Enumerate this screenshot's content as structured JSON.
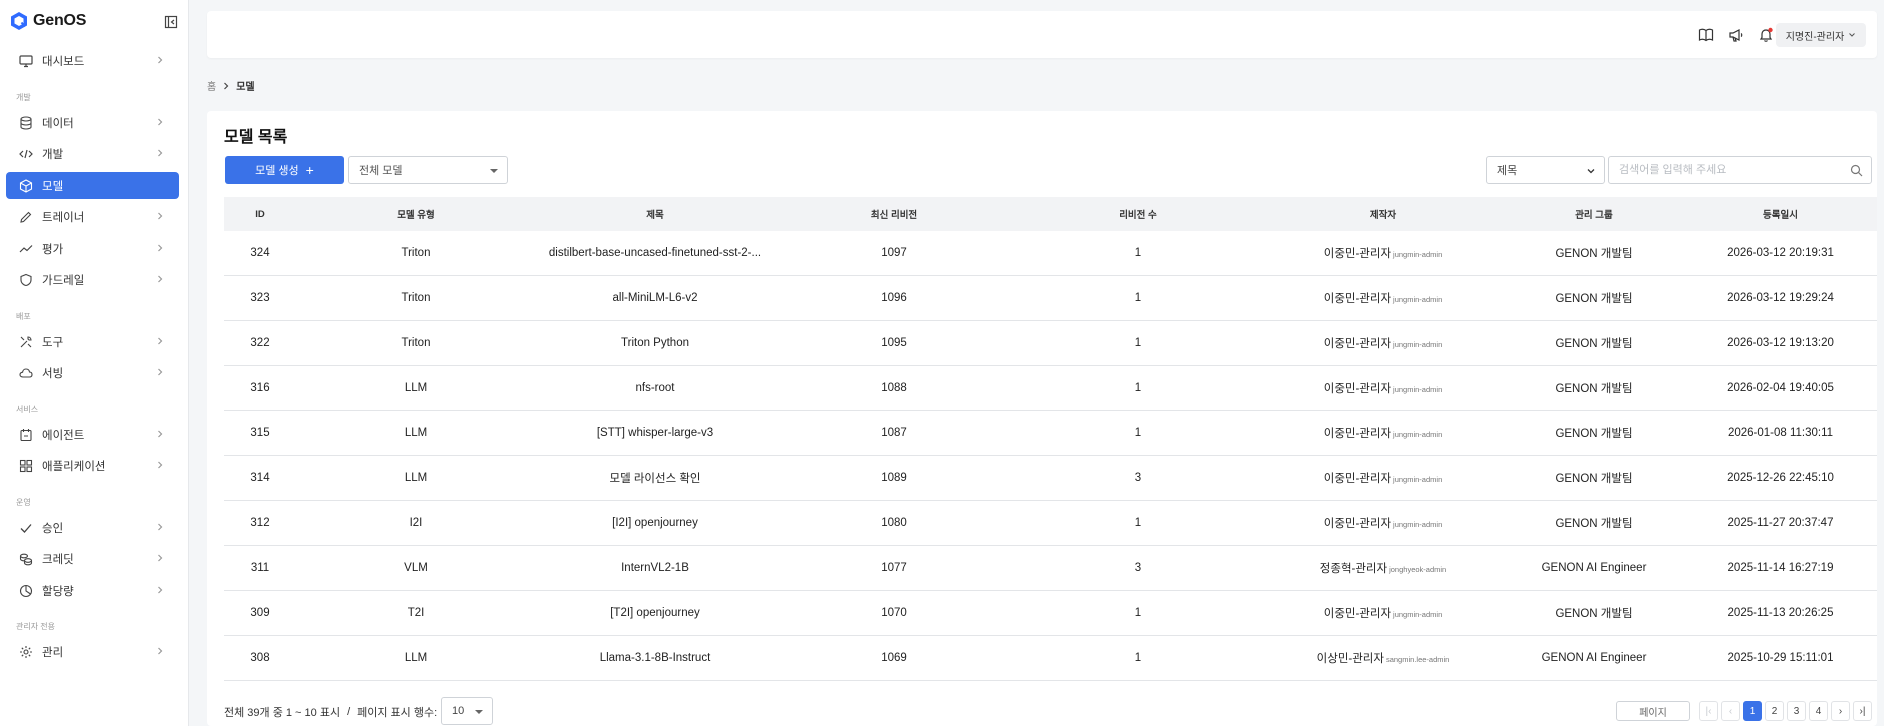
{
  "app": {
    "name": "GenOS"
  },
  "sidebar": {
    "sections": {
      "dev": "개발",
      "deploy": "배포",
      "service": "서비스",
      "ops": "운영",
      "admin": "관리자 전용"
    },
    "items": [
      {
        "label": "대시보드",
        "icon": "monitor-icon"
      },
      {
        "label": "데이터",
        "icon": "database-icon"
      },
      {
        "label": "개발",
        "icon": "code-icon"
      },
      {
        "label": "모델",
        "icon": "cube-icon",
        "active": true
      },
      {
        "label": "트레이너",
        "icon": "pencil-icon"
      },
      {
        "label": "평가",
        "icon": "trend-icon"
      },
      {
        "label": "가드레일",
        "icon": "shield-icon"
      },
      {
        "label": "도구",
        "icon": "tools-icon"
      },
      {
        "label": "서빙",
        "icon": "cloud-icon"
      },
      {
        "label": "에이전트",
        "icon": "calendar-icon"
      },
      {
        "label": "애플리케이션",
        "icon": "apps-icon"
      },
      {
        "label": "승인",
        "icon": "check-icon"
      },
      {
        "label": "크레딧",
        "icon": "coins-icon"
      },
      {
        "label": "할당량",
        "icon": "pie-icon"
      },
      {
        "label": "관리",
        "icon": "gear-icon"
      }
    ]
  },
  "header": {
    "user": "지명진-관리자",
    "icons": [
      "book-icon",
      "megaphone-icon",
      "bell-icon"
    ]
  },
  "breadcrumb": {
    "home": "홈",
    "current": "모델"
  },
  "main": {
    "title": "모델 목록",
    "create_button": "모델 생성",
    "model_filter": "전체 모델",
    "search_field": "제목",
    "search_placeholder": "검색어를 입력해 주세요"
  },
  "table": {
    "headers": [
      "ID",
      "모델 유형",
      "제목",
      "최신 리비전",
      "리비전 수",
      "제작자",
      "관리 그룹",
      "등록일시"
    ],
    "rows": [
      {
        "id": "324",
        "type": "Triton",
        "title": "distilbert-base-uncased-finetuned-sst-2-...",
        "rev": "1097",
        "count": "1",
        "creator": "이중민-관리자",
        "creator_id": "jungmin-admin",
        "group": "GENON 개발팀",
        "date": "2026-03-12 20:19:31"
      },
      {
        "id": "323",
        "type": "Triton",
        "title": "all-MiniLM-L6-v2",
        "rev": "1096",
        "count": "1",
        "creator": "이중민-관리자",
        "creator_id": "jungmin-admin",
        "group": "GENON 개발팀",
        "date": "2026-03-12 19:29:24"
      },
      {
        "id": "322",
        "type": "Triton",
        "title": "Triton Python",
        "rev": "1095",
        "count": "1",
        "creator": "이중민-관리자",
        "creator_id": "jungmin-admin",
        "group": "GENON 개발팀",
        "date": "2026-03-12 19:13:20"
      },
      {
        "id": "316",
        "type": "LLM",
        "title": "nfs-root",
        "rev": "1088",
        "count": "1",
        "creator": "이중민-관리자",
        "creator_id": "jungmin-admin",
        "group": "GENON 개발팀",
        "date": "2026-02-04 19:40:05"
      },
      {
        "id": "315",
        "type": "LLM",
        "title": "[STT] whisper-large-v3",
        "rev": "1087",
        "count": "1",
        "creator": "이중민-관리자",
        "creator_id": "jungmin-admin",
        "group": "GENON 개발팀",
        "date": "2026-01-08 11:30:11"
      },
      {
        "id": "314",
        "type": "LLM",
        "title": "모델 라이선스 확인",
        "rev": "1089",
        "count": "3",
        "creator": "이중민-관리자",
        "creator_id": "jungmin-admin",
        "group": "GENON 개발팀",
        "date": "2025-12-26 22:45:10"
      },
      {
        "id": "312",
        "type": "I2I",
        "title": "[I2I] openjourney",
        "rev": "1080",
        "count": "1",
        "creator": "이중민-관리자",
        "creator_id": "jungmin-admin",
        "group": "GENON 개발팀",
        "date": "2025-11-27 20:37:47"
      },
      {
        "id": "311",
        "type": "VLM",
        "title": "InternVL2-1B",
        "rev": "1077",
        "count": "3",
        "creator": "정종혁-관리자",
        "creator_id": "jonghyeok-admin",
        "group": "GENON AI Engineer",
        "date": "2025-11-14 16:27:19"
      },
      {
        "id": "309",
        "type": "T2I",
        "title": "[T2I] openjourney",
        "rev": "1070",
        "count": "1",
        "creator": "이중민-관리자",
        "creator_id": "jungmin-admin",
        "group": "GENON 개발팀",
        "date": "2025-11-13 20:26:25"
      },
      {
        "id": "308",
        "type": "LLM",
        "title": "Llama-3.1-8B-Instruct",
        "rev": "1069",
        "count": "1",
        "creator": "이상민-관리자",
        "creator_id": "sangmin.lee-admin",
        "group": "GENON AI Engineer",
        "date": "2025-10-29 15:11:01"
      }
    ]
  },
  "footer": {
    "summary": "전체 39개 중 1 ~ 10 표시",
    "divider": "/",
    "rows_label": "페이지 표시 행수:",
    "rows_value": "10",
    "page_input": "페이지",
    "pages": [
      "1",
      "2",
      "3",
      "4"
    ],
    "current_page": "1"
  },
  "colors": {
    "accent": "#3a72e8",
    "notification": "#e53935"
  }
}
